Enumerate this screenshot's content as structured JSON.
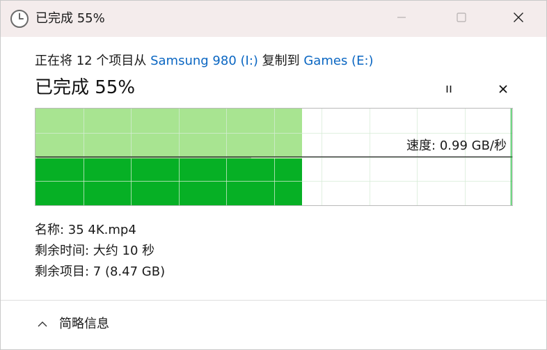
{
  "window": {
    "title": "已完成 55%"
  },
  "copy": {
    "prefix": "正在将 12 个项目从 ",
    "source": "Samsung 980 (I:)",
    "middle": " 复制到 ",
    "destination": "Games (E:)",
    "status": "已完成 55%",
    "progress_fraction": 0.55
  },
  "speed": {
    "label": "速度: 0.99 GB/秒"
  },
  "details": {
    "name": "名称:  35 4K.mp4",
    "time_remaining": "剩余时间:  大约 10 秒",
    "items_remaining": "剩余项目:  7 (8.47 GB)"
  },
  "footer": {
    "toggle_label": "简略信息"
  },
  "colors": {
    "progress_fill": "#a8e491",
    "speed_fill": "#06b025",
    "grid": "#d6ecd6",
    "link": "#0a66c2"
  }
}
